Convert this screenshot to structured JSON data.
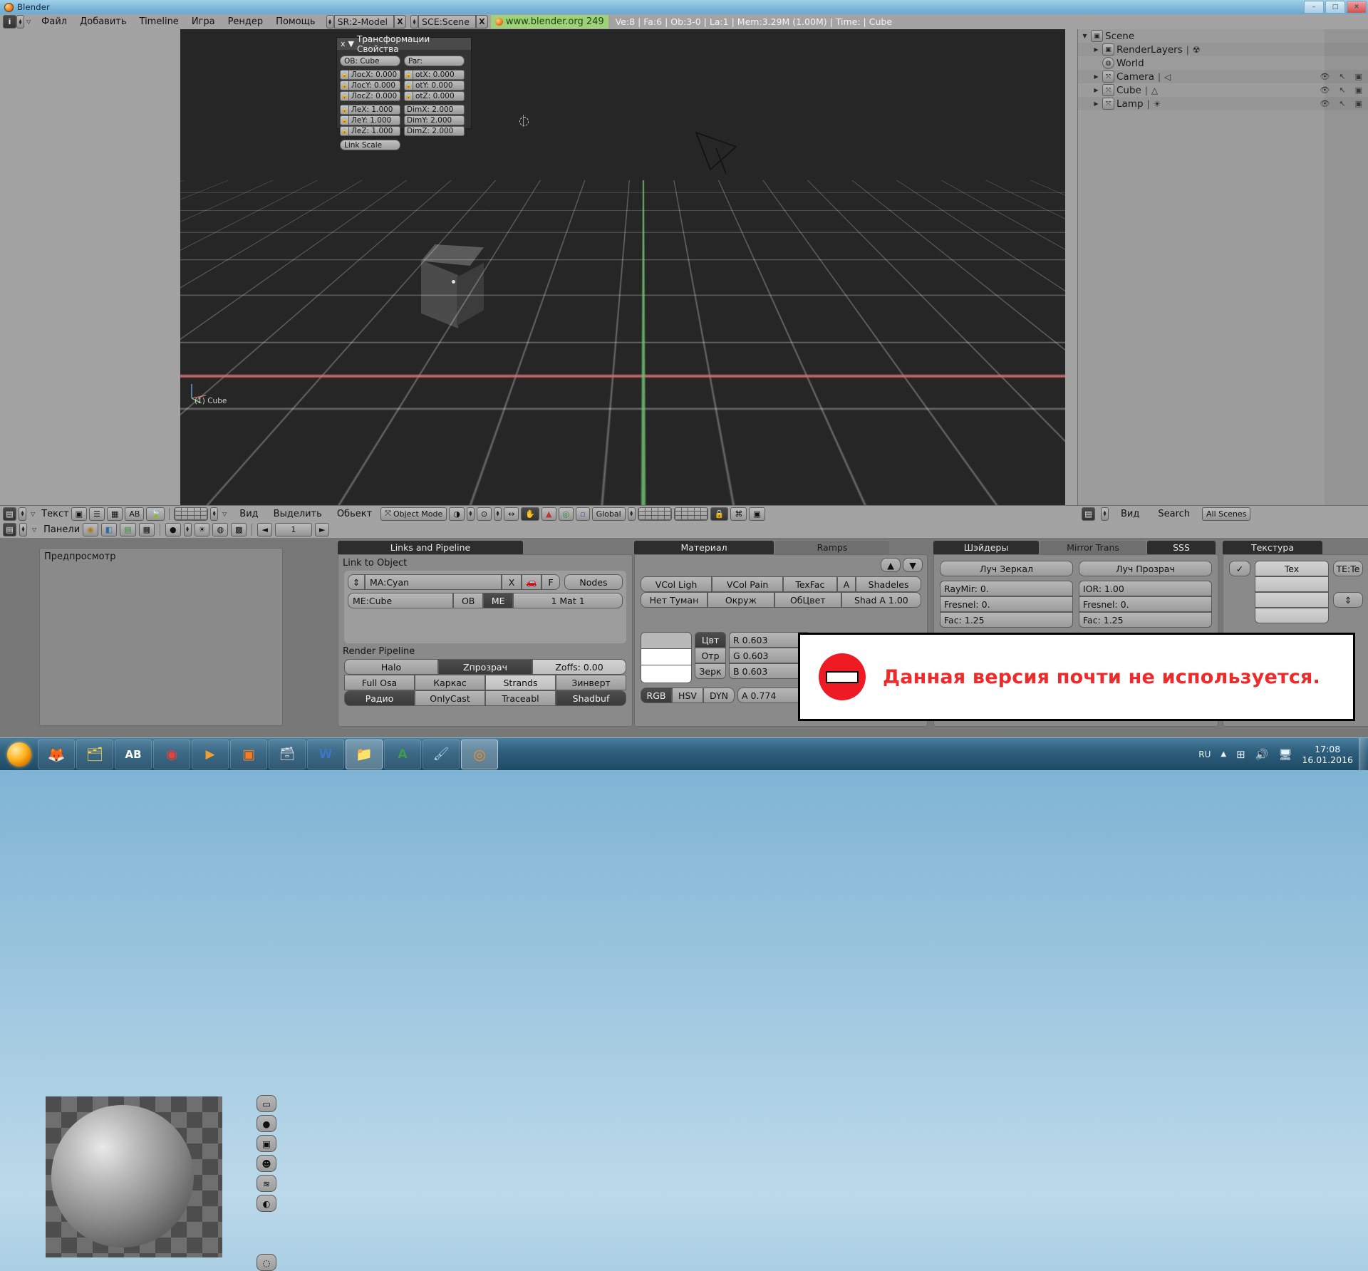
{
  "window": {
    "title": "Blender",
    "minimize": "–",
    "maximize": "□",
    "close": "✕"
  },
  "header": {
    "menus": [
      "Файл",
      "Добавить",
      "Timeline",
      "Игра",
      "Рендер",
      "Помощь"
    ],
    "screen_field": "SR:2-Model",
    "scene_field": "SCE:Scene",
    "clear_label": "X",
    "url": "www.blender.org 249",
    "stats": "Ve:8 | Fa:6 | Ob:3-0 | La:1  | Mem:3.29M (1.00M)  | Time: | Cube"
  },
  "transform_panel": {
    "title": "Трансформации Свойства",
    "close": "x",
    "collapse": "▼",
    "ob_field": "OB: Cube",
    "par_field": "Par:",
    "loc": [
      {
        "label": "ЛocX: 0.000"
      },
      {
        "label": "ЛocY: 0.000"
      },
      {
        "label": "ЛocZ: 0.000"
      }
    ],
    "rot": [
      {
        "label": "otX: 0.000"
      },
      {
        "label": "otY: 0.000"
      },
      {
        "label": "otZ: 0.000"
      }
    ],
    "scale": [
      {
        "label": "ЛeX: 1.000"
      },
      {
        "label": "ЛeY: 1.000"
      },
      {
        "label": "ЛeZ: 1.000"
      }
    ],
    "dim": [
      {
        "label": "DimX: 2.000"
      },
      {
        "label": "DimY: 2.000"
      },
      {
        "label": "DimZ: 2.000"
      }
    ],
    "link_scale": "Link Scale"
  },
  "viewport": {
    "object_label": "(1) Cube"
  },
  "outliner": {
    "rows": [
      {
        "indent": 0,
        "tri": "▼",
        "icon": "scene-icon",
        "glyph": "▣",
        "label": "Scene",
        "extra": "",
        "controls": false
      },
      {
        "indent": 1,
        "tri": "▶",
        "icon": "renderlayers-icon",
        "glyph": "▣",
        "label": "RenderLayers",
        "extra": "☢",
        "controls": false
      },
      {
        "indent": 1,
        "tri": "",
        "icon": "world-icon",
        "glyph": "◍",
        "label": "World",
        "extra": "",
        "controls": false
      },
      {
        "indent": 1,
        "tri": "▶",
        "icon": "object-icon",
        "glyph": "⤧",
        "label": "Camera",
        "extra": "◁",
        "controls": true
      },
      {
        "indent": 1,
        "tri": "▶",
        "icon": "object-icon",
        "glyph": "⤧",
        "label": "Cube",
        "extra": "△",
        "controls": true
      },
      {
        "indent": 1,
        "tri": "▶",
        "icon": "object-icon",
        "glyph": "⤧",
        "label": "Lamp",
        "extra": "☀",
        "controls": true
      }
    ],
    "col_icons": [
      "👁",
      "↖",
      "▣"
    ]
  },
  "text_header": {
    "editor_label": "Текст",
    "icons": [
      "text-draw-icon",
      "lines-icon",
      "grid-icon",
      "ab-icon",
      "plugin-icon"
    ]
  },
  "view3d_header": {
    "menus": [
      "Вид",
      "Выделить",
      "Обьект"
    ],
    "mode": "Object Mode",
    "orientation": "Global",
    "icons": [
      "editor-type-icon",
      "shading-icon",
      "pivot-icon",
      "manipulator-icon",
      "rotate-icon",
      "scale-icon",
      "layers-icon",
      "lock-icon",
      "link-icon",
      "render-icon"
    ]
  },
  "outliner_header": {
    "view_menu": "Вид",
    "search_label": "Search",
    "scope": "All Scenes"
  },
  "buttons_header": {
    "label": "Панели",
    "frame_value": "1"
  },
  "preview_panel": {
    "title": "Предпросмотр",
    "side_icons": [
      "plane-preview-icon",
      "sphere-preview-icon",
      "cube-preview-icon",
      "monkey-preview-icon",
      "hair-preview-icon",
      "sky-preview-icon"
    ]
  },
  "links_panel": {
    "tab": "Links and Pipeline",
    "section_link": "Link to Object",
    "material_field": "MA:Cyan",
    "clear_btn": "X",
    "car_btn": "car-icon",
    "fake_user_btn": "F",
    "nodes_btn": "Nodes",
    "mesh_field": "ME:Cube",
    "ob_btn": "OB",
    "me_btn": "ME",
    "mat_index": "1 Mat 1",
    "section_pipeline": "Render Pipeline",
    "pipeline_rows": [
      [
        "Halo",
        "Zпрозрач",
        "Zoffs: 0.00"
      ],
      [
        "Full Osa",
        "Каркас",
        "Strands",
        "Зинверт"
      ],
      [
        "Радио",
        "OnlyCast",
        "Traceabl",
        "Shadbuf"
      ]
    ]
  },
  "material_panel": {
    "tab_material": "Материал",
    "tab_ramps": "Ramps",
    "toggles_row1": [
      "VCol Ligh",
      "VCol Pain",
      "TexFac",
      "A",
      "Shadeles"
    ],
    "toggles_row2": [
      "Нет Туман",
      "Окруж",
      "ОбЦвет",
      "Shad A 1.00"
    ],
    "channels": [
      "Цвт",
      "Отр",
      "Зерк"
    ],
    "rgb_values": [
      "R 0.603",
      "G 0.603",
      "B 0.603"
    ],
    "mode_buttons": [
      "RGB",
      "HSV",
      "DYN"
    ],
    "alpha": "A 0.774"
  },
  "shaders_panel": {
    "tab_shaders": "Шэйдеры",
    "tab_mirror": "Mirror Trans",
    "tab_sss": "SSS",
    "left_title": "Луч Зеркал",
    "right_title": "Луч Прозрач",
    "left_sliders": [
      "RayMir: 0.",
      "Fresnel: 0.",
      "Fac: 1.25"
    ],
    "right_sliders": [
      "IOR: 1.00",
      "Fresnel: 0.",
      "Fac: 1.25"
    ]
  },
  "texture_panel": {
    "tab": "Текстура",
    "check": "✓",
    "slot": "Tex",
    "te_label": "TE:Te"
  },
  "dialog": {
    "icon": "no-entry-icon",
    "message": "Данная версия почти не используется."
  },
  "taskbar": {
    "start": "start-orb-icon",
    "items": [
      "firefox-icon",
      "explorer-icon",
      "abbyy-icon",
      "opera-icon",
      "media-player-icon",
      "vlc-icon",
      "folder-stack-icon",
      "word-icon",
      "files-icon",
      "excel-icon",
      "paint-icon",
      "chrome-icon"
    ],
    "language": "RU",
    "tray_icons": [
      "show-hidden-icon",
      "network-icon",
      "volume-icon",
      "display-icon"
    ],
    "time": "17:08",
    "date": "16.01.2016"
  }
}
